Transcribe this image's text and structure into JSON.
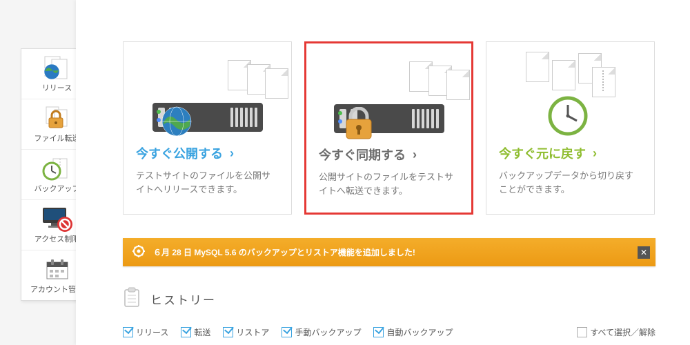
{
  "sidebar": {
    "items": [
      {
        "label": "リリース"
      },
      {
        "label": "ファイル転送"
      },
      {
        "label": "バックアップ"
      },
      {
        "label": "アクセス制限"
      },
      {
        "label": "アカウント管理"
      }
    ]
  },
  "cards": [
    {
      "title": "今すぐ公開する",
      "desc": "テストサイトのファイルを公開サイトへリリースできます。",
      "color": "blue",
      "highlight": false
    },
    {
      "title": "今すぐ同期する",
      "desc": "公開サイトのファイルをテストサイトへ転送できます。",
      "color": "gray",
      "highlight": true
    },
    {
      "title": "今すぐ元に戻す",
      "desc": "バックアップデータから切り戻すことができます。",
      "color": "green",
      "highlight": false
    }
  ],
  "notice": {
    "text": "６月 28 日  MySQL 5.6 のバックアップとリストア機能を追加しました!"
  },
  "history": {
    "title": "ヒストリー"
  },
  "filters": {
    "items": [
      {
        "label": "リリース",
        "checked": true
      },
      {
        "label": "転送",
        "checked": true
      },
      {
        "label": "リストア",
        "checked": true
      },
      {
        "label": "手動バックアップ",
        "checked": true
      },
      {
        "label": "自動バックアップ",
        "checked": true
      }
    ],
    "select_all": "すべて選択／解除"
  },
  "chev": "›"
}
